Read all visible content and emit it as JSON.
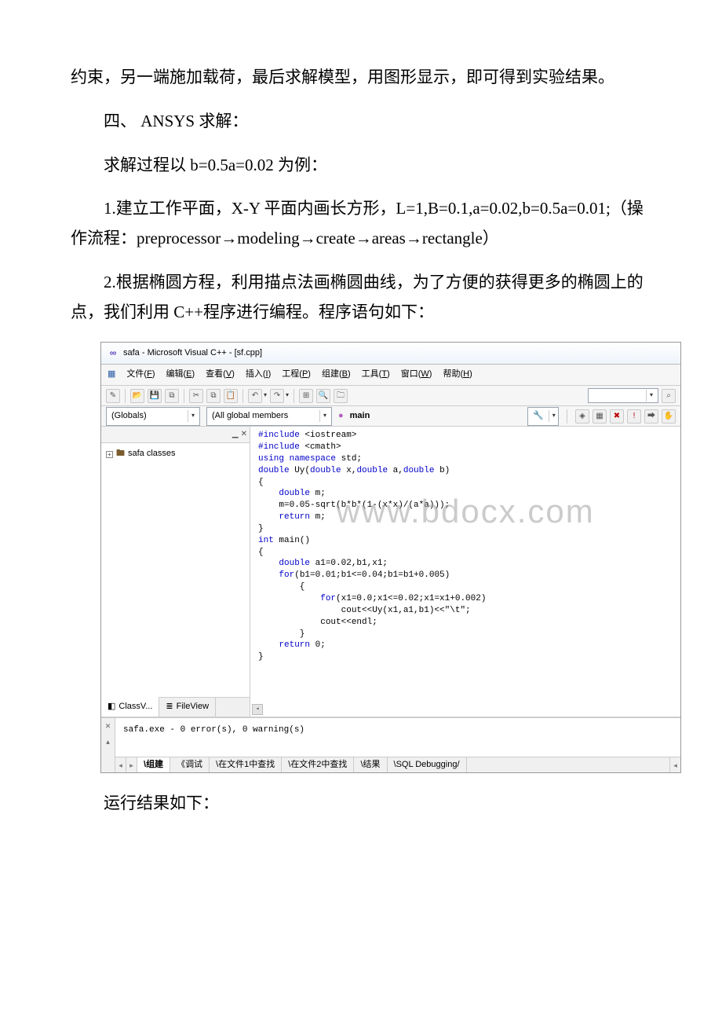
{
  "doc": {
    "p1": "约束，另一端施加载荷，最后求解模型，用图形显示，即可得到实验结果。",
    "p2": "四、 ANSYS 求解：",
    "p3": "求解过程以 b=0.5a=0.02 为例：",
    "p4": "1.建立工作平面，X-Y 平面内画长方形，L=1,B=0.1,a=0.02,b=0.5a=0.01;（操作流程：preprocessor→modeling→create→areas→rectangle）",
    "p5": "2.根据椭圆方程，利用描点法画椭圆曲线，为了方便的获得更多的椭圆上的点，我们利用 C++程序进行编程。程序语句如下：",
    "p6": "运行结果如下："
  },
  "ide": {
    "title": "safa - Microsoft Visual C++ - [sf.cpp]",
    "menu": [
      {
        "label": "文件",
        "key": "F"
      },
      {
        "label": "编辑",
        "key": "E"
      },
      {
        "label": "查看",
        "key": "V"
      },
      {
        "label": "插入",
        "key": "I"
      },
      {
        "label": "工程",
        "key": "P"
      },
      {
        "label": "组建",
        "key": "B"
      },
      {
        "label": "工具",
        "key": "T"
      },
      {
        "label": "窗口",
        "key": "W"
      },
      {
        "label": "帮助",
        "key": "H"
      }
    ],
    "toolbar": [
      "new",
      "open",
      "save",
      "save-all",
      "cut",
      "copy",
      "paste",
      "undo",
      "redo",
      "find",
      "find-next",
      "bookmark"
    ],
    "combo1": "(Globals)",
    "combo2": "(All global members",
    "funcIcon": "●",
    "funcLabel": "main",
    "toolbar_right": [
      "book",
      "nav",
      "bp",
      "stop",
      "cur",
      "print"
    ],
    "tree": {
      "root": "safa classes",
      "tab1": "ClassV...",
      "tab2": "FileView"
    },
    "code": [
      "#include <iostream>",
      "#include <cmath>",
      "using namespace std;",
      "double Uy(double x,double a,double b)",
      "{",
      "    double m;",
      "    m=0.05-sqrt(b*b*(1-(x*x)/(a*a)));",
      "    return m;",
      "}",
      "int main()",
      "{",
      "    double a1=0.02,b1,x1;",
      "    for(b1=0.01;b1<=0.04;b1=b1+0.005)",
      "        {",
      "            for(x1=0.0;x1<=0.02;x1=x1+0.002)",
      "                cout<<Uy(x1,a1,b1)<<\"\\t\";",
      "            cout<<endl;",
      "        }",
      "    return 0;",
      "}"
    ],
    "code_keywords": [
      "#include",
      "using",
      "namespace",
      "double",
      "return",
      "int",
      "for"
    ],
    "output": "safa.exe - 0 error(s), 0 warning(s)",
    "out_tabs": [
      "组建",
      "调试",
      "在文件1中查找",
      "在文件2中查找",
      "结果",
      "SQL Debugging"
    ],
    "watermark": "www.bdocx.com"
  }
}
